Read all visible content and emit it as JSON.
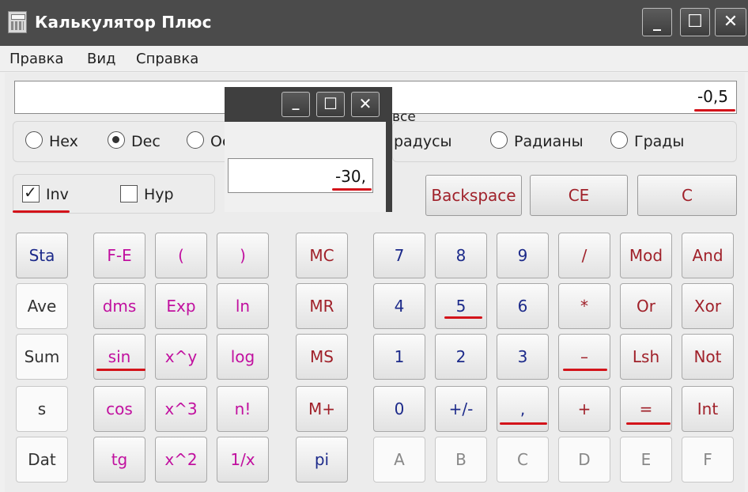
{
  "window": {
    "title": "Калькулятор Плюс",
    "icon": "calculator-icon",
    "minimize": "_",
    "maximize": "☐",
    "close": "✕"
  },
  "menu": [
    "Правка",
    "Вид",
    "Справка"
  ],
  "display": {
    "value": "-0,5"
  },
  "number_base": {
    "options": [
      "Hex",
      "Dec",
      "Oct"
    ],
    "selected": "Dec",
    "partial_label": "Oc",
    "obscured_label_left": "все",
    "obscured_label_right": "радусы"
  },
  "angle_units": {
    "options": [
      "Радианы",
      "Грады"
    ]
  },
  "checkboxes": {
    "inv": {
      "label": "Inv",
      "checked": true,
      "check_glyph": "✓"
    },
    "hyp": {
      "label": "Hyp",
      "checked": false
    }
  },
  "top_buttons": {
    "backspace": "Backspace",
    "ce": "CE",
    "c": "C"
  },
  "keys": {
    "col_stat": [
      "Sta",
      "Ave",
      "Sum",
      "s",
      "Dat"
    ],
    "col_f1": [
      "F-E",
      "dms",
      "sin",
      "cos",
      "tg"
    ],
    "col_f2": [
      "(",
      "Exp",
      "x^y",
      "x^3",
      "x^2"
    ],
    "col_f3": [
      ")",
      "ln",
      "log",
      "n!",
      "1/x"
    ],
    "col_mem": [
      "MC",
      "MR",
      "MS",
      "M+",
      "pi"
    ],
    "col_n1": [
      "7",
      "4",
      "1",
      "0",
      "A"
    ],
    "col_n2": [
      "8",
      "5",
      "2",
      "+/-",
      "B"
    ],
    "col_n3": [
      "9",
      "6",
      "3",
      ",",
      "C"
    ],
    "col_op1": [
      "/",
      "*",
      "–",
      "+",
      "D"
    ],
    "col_op2": [
      "Mod",
      "Or",
      "Lsh",
      "=",
      "E"
    ],
    "col_op3": [
      "And",
      "Xor",
      "Not",
      "Int",
      "F"
    ]
  },
  "overlay_window": {
    "display_value": "-30,",
    "minimize": "_",
    "maximize": "☐",
    "close": "✕"
  },
  "colors": {
    "title_bar": "#4b4b4b",
    "function_key_text": "#c1109f",
    "memory_key_text": "#a0212a",
    "digit_key_text": "#1c2a8a",
    "highlight_underline": "#d3131a"
  }
}
